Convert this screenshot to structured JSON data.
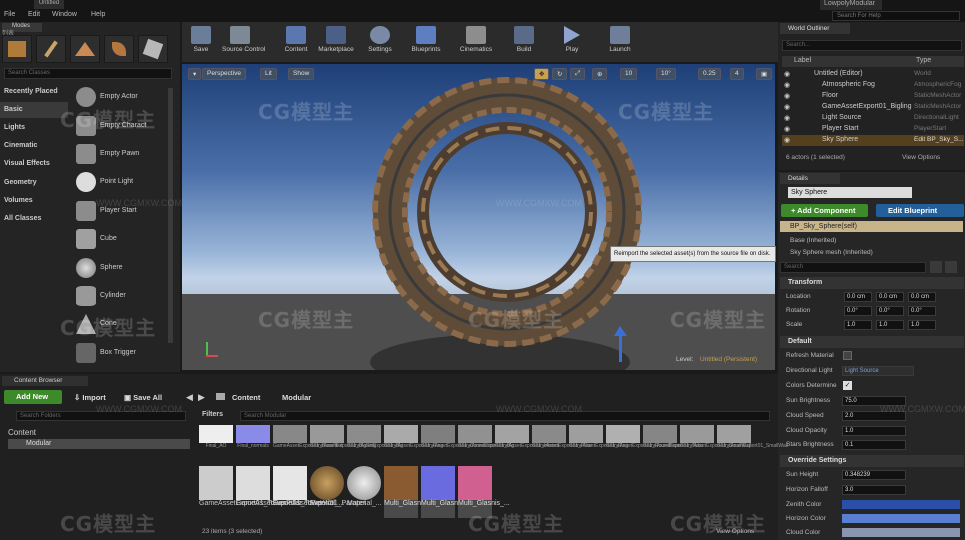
{
  "menubar": {
    "tab": "Untitled",
    "items": [
      "File",
      "Edit",
      "Window",
      "Help"
    ],
    "project": "LowpolyModular",
    "help_search": "Search For Help"
  },
  "modes": {
    "tab": "Modes",
    "tab_suffix": "列表",
    "search_placeholder": "Search Classes",
    "categories": [
      "Recently Placed",
      "Basic",
      "Lights",
      "Cinematic",
      "Visual Effects",
      "Geometry",
      "Volumes",
      "All Classes"
    ],
    "selected_category": "Basic",
    "items": [
      "Empty Actor",
      "Empty Charact",
      "Empty Pawn",
      "Point Light",
      "Player Start",
      "Cube",
      "Sphere",
      "Cylinder",
      "Cone",
      "Box Trigger"
    ]
  },
  "toolbar": [
    "Save",
    "Source Control",
    "Content",
    "Marketplace",
    "Settings",
    "Blueprints",
    "Cinematics",
    "Build",
    "Play",
    "Launch"
  ],
  "viewport": {
    "perspective": "Perspective",
    "lit": "Lit",
    "show": "Show",
    "grid": "10",
    "angle": "10°",
    "scale": "0.25",
    "cam": "4",
    "level_label": "Level:",
    "level_name": "Untitled (Persistent)"
  },
  "tooltip": "Reimport the selected asset(s) from the source file on disk.",
  "outliner": {
    "title": "World Outliner",
    "search_placeholder": "Search...",
    "col_label": "Label",
    "col_type": "Type",
    "rows": [
      {
        "label": "Untitled (Editor)",
        "type": "World"
      },
      {
        "label": "Atmospheric Fog",
        "type": "AtmosphericFog"
      },
      {
        "label": "Floor",
        "type": "StaticMeshActor"
      },
      {
        "label": "GameAssetExport01_Bigling",
        "type": "StaticMeshActor"
      },
      {
        "label": "Light Source",
        "type": "DirectionalLight"
      },
      {
        "label": "Player Start",
        "type": "PlayerStart"
      },
      {
        "label": "Sky Sphere",
        "type": "Edit BP_Sky_S..."
      }
    ],
    "selected": "Sky Sphere",
    "count": "6 actors (1 selected)",
    "view_options": "View Options"
  },
  "details": {
    "title": "Details",
    "name": "Sky Sphere",
    "add_component": "+ Add Component",
    "edit_blueprint": "Edit Blueprint",
    "bp_self": "BP_Sky_Sphere(self)",
    "inherited": "Base (Inherited)",
    "inherited2": "Sky Sphere mesh (Inherited)",
    "search_placeholder": "Search",
    "transform": "Transform",
    "location_label": "Location",
    "location": [
      "0.0 cm",
      "0.0 cm",
      "0.0 cm"
    ],
    "rotation_label": "Rotation",
    "rotation": [
      "0.0°",
      "0.0°",
      "0.0°"
    ],
    "scale_label": "Scale",
    "scale": [
      "1.0",
      "1.0",
      "1.0"
    ],
    "default": "Default",
    "props": [
      {
        "name": "Refresh Material",
        "value": ""
      },
      {
        "name": "Directional Light",
        "value": "Light Source"
      },
      {
        "name": "Colors Determine",
        "value": ""
      },
      {
        "name": "Sun Brightness",
        "value": "75.0"
      },
      {
        "name": "Cloud Speed",
        "value": "2.0"
      },
      {
        "name": "Cloud Opacity",
        "value": "1.0"
      },
      {
        "name": "Stars Brightness",
        "value": "0.1"
      }
    ],
    "override": "Override Settings",
    "oprops": [
      {
        "name": "Sun Height",
        "value": "0.348239"
      },
      {
        "name": "Horizon Falloff",
        "value": "3.0"
      },
      {
        "name": "Zenith Color",
        "value": ""
      },
      {
        "name": "Horizon Color",
        "value": ""
      },
      {
        "name": "Cloud Color",
        "value": ""
      }
    ]
  },
  "content_browser": {
    "tab": "Content Browser",
    "add_new": "Add New",
    "import": "Import",
    "save_all": "Save All",
    "path": [
      "Content",
      "Modular"
    ],
    "filters": "Filters",
    "search_placeholder": "Search Modular",
    "search_folders": "Search Folders",
    "folders": [
      "Content",
      "Modular"
    ],
    "assets_row1": [
      "Final_AO",
      "Final_normals",
      "GameAssetExport01_Baseflind",
      "GameAssetExport01_BigRing",
      "GameAssetExport01_Big",
      "GameAssetExport01_Ring",
      "GameAssetExport01_Connection",
      "GameAssetExport01_Big",
      "GameAssetExport01_Inteiror",
      "GameAssetExport01_Pillar",
      "GameAssetExport01_Ring",
      "GameAssetExport01_RoundBase",
      "GameAssetExport01_Tubo",
      "GameAssetExport01_SmallWall",
      "GameAssetExport01_SmallWall"
    ],
    "assets_row2": [
      "GameAssetExport01_TowerPillar",
      "GameAssetExport01_TowerWall",
      "GameAssetExport01_Parapet",
      "Material_...",
      "Material_...",
      "Multi_Glasnis_Base",
      "Multi_Glasnis_Normal",
      "Multi_Glasnis_..."
    ],
    "count": "23 items (3 selected)",
    "view_options": "View Options"
  },
  "watermarks": [
    "CG模型主",
    "WWW.CGMXW.COM"
  ]
}
